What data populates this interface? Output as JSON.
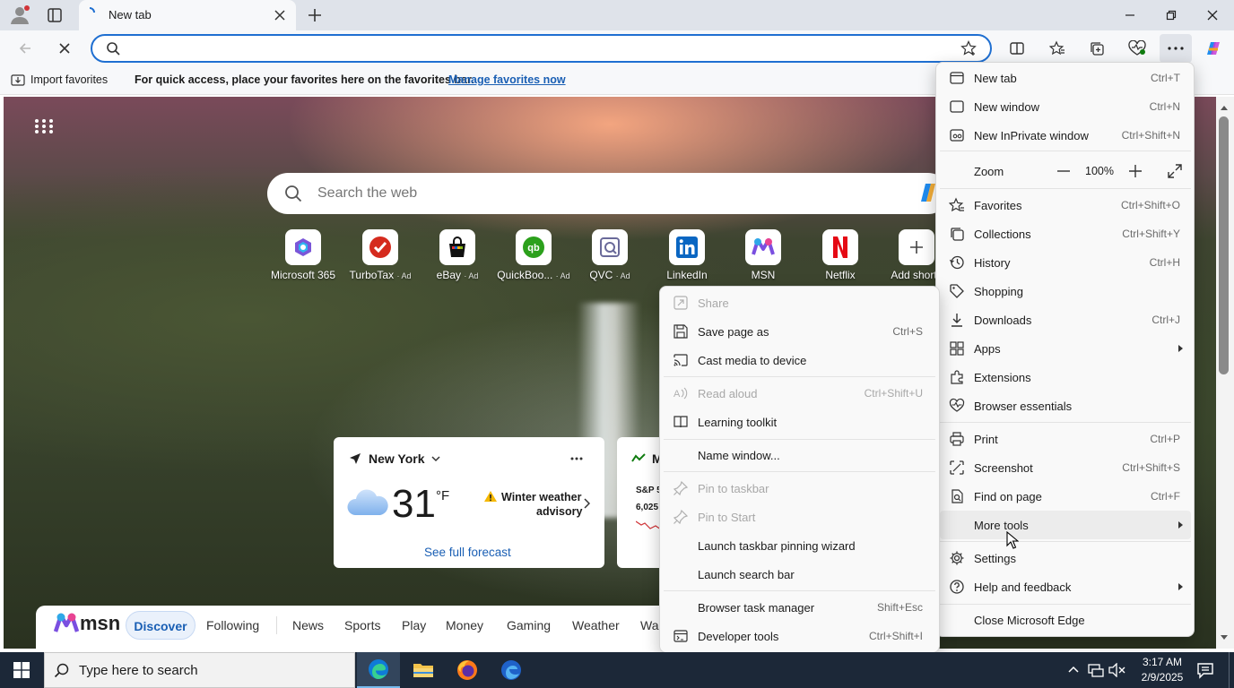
{
  "tab": {
    "title": "New tab"
  },
  "favbar": {
    "import_label": "Import favorites",
    "hint": "For quick access, place your favorites here on the favorites bar.",
    "manage_link": "Manage favorites now"
  },
  "page": {
    "search_placeholder": "Search the web",
    "quick_links": [
      {
        "label": "Microsoft 365",
        "ad": "",
        "icon": "microsoft365-icon"
      },
      {
        "label": "TurboTax",
        "ad": "· Ad",
        "icon": "turbotax-icon"
      },
      {
        "label": "eBay",
        "ad": "· Ad",
        "icon": "ebay-icon"
      },
      {
        "label": "QuickBoo...",
        "ad": "· Ad",
        "icon": "quickbooks-icon"
      },
      {
        "label": "QVC",
        "ad": "· Ad",
        "icon": "qvc-icon"
      },
      {
        "label": "LinkedIn",
        "ad": "",
        "icon": "linkedin-icon"
      },
      {
        "label": "MSN",
        "ad": "",
        "icon": "msn-icon"
      },
      {
        "label": "Netflix",
        "ad": "",
        "icon": "netflix-icon"
      },
      {
        "label": "Add shortc",
        "ad": "",
        "icon": "plus-icon"
      }
    ],
    "weather": {
      "location": "New York",
      "temp": "31",
      "unit": "°F",
      "alert_line1": "Winter weather",
      "alert_line2": "advisory",
      "forecast_link": "See full forecast"
    },
    "market": {
      "title": "M",
      "line1": "S&P 5",
      "line2": "6,025"
    },
    "msn": {
      "logo": "msn",
      "tabs": [
        "Discover",
        "Following",
        "News",
        "Sports",
        "Play",
        "Money",
        "Gaming",
        "Weather",
        "Wa"
      ]
    }
  },
  "main_menu": {
    "items": [
      {
        "label": "New tab",
        "shortcut": "Ctrl+T",
        "icon": "new-tab-icon"
      },
      {
        "label": "New window",
        "shortcut": "Ctrl+N",
        "icon": "new-window-icon"
      },
      {
        "label": "New InPrivate window",
        "shortcut": "Ctrl+Shift+N",
        "icon": "inprivate-icon"
      }
    ],
    "zoom": {
      "label": "Zoom",
      "value": "100%"
    },
    "items2": [
      {
        "label": "Favorites",
        "shortcut": "Ctrl+Shift+O",
        "icon": "favorites-icon"
      },
      {
        "label": "Collections",
        "shortcut": "Ctrl+Shift+Y",
        "icon": "collections-icon"
      },
      {
        "label": "History",
        "shortcut": "Ctrl+H",
        "icon": "history-icon"
      },
      {
        "label": "Shopping",
        "shortcut": "",
        "icon": "shopping-icon"
      },
      {
        "label": "Downloads",
        "shortcut": "Ctrl+J",
        "icon": "downloads-icon"
      },
      {
        "label": "Apps",
        "shortcut": "",
        "icon": "apps-icon"
      },
      {
        "label": "Extensions",
        "shortcut": "",
        "icon": "extensions-icon"
      },
      {
        "label": "Browser essentials",
        "shortcut": "",
        "icon": "browser-essentials-icon"
      }
    ],
    "items3": [
      {
        "label": "Print",
        "shortcut": "Ctrl+P",
        "icon": "print-icon"
      },
      {
        "label": "Screenshot",
        "shortcut": "Ctrl+Shift+S",
        "icon": "screenshot-icon"
      },
      {
        "label": "Find on page",
        "shortcut": "Ctrl+F",
        "icon": "find-icon"
      },
      {
        "label": "More tools",
        "shortcut": "",
        "icon": ""
      }
    ],
    "items4": [
      {
        "label": "Settings",
        "shortcut": "",
        "icon": "settings-icon"
      },
      {
        "label": "Help and feedback",
        "shortcut": "",
        "icon": "help-icon"
      }
    ],
    "close": {
      "label": "Close Microsoft Edge"
    }
  },
  "sub_menu": {
    "items": [
      {
        "label": "Share",
        "shortcut": "",
        "disabled": true
      },
      {
        "label": "Save page as",
        "shortcut": "Ctrl+S",
        "disabled": false
      },
      {
        "label": "Cast media to device",
        "shortcut": "",
        "disabled": false
      },
      {
        "label": "Read aloud",
        "shortcut": "Ctrl+Shift+U",
        "disabled": true
      },
      {
        "label": "Learning toolkit",
        "shortcut": "",
        "disabled": false
      },
      {
        "label": "Name window...",
        "shortcut": "",
        "disabled": false
      },
      {
        "label": "Pin to taskbar",
        "shortcut": "",
        "disabled": true
      },
      {
        "label": "Pin to Start",
        "shortcut": "",
        "disabled": true
      },
      {
        "label": "Launch taskbar pinning wizard",
        "shortcut": "",
        "disabled": false
      },
      {
        "label": "Launch search bar",
        "shortcut": "",
        "disabled": false
      },
      {
        "label": "Browser task manager",
        "shortcut": "Shift+Esc",
        "disabled": false
      },
      {
        "label": "Developer tools",
        "shortcut": "Ctrl+Shift+I",
        "disabled": false
      }
    ]
  },
  "taskbar": {
    "search_placeholder": "Type here to search",
    "time": "3:17 AM",
    "date": "2/9/2025"
  }
}
